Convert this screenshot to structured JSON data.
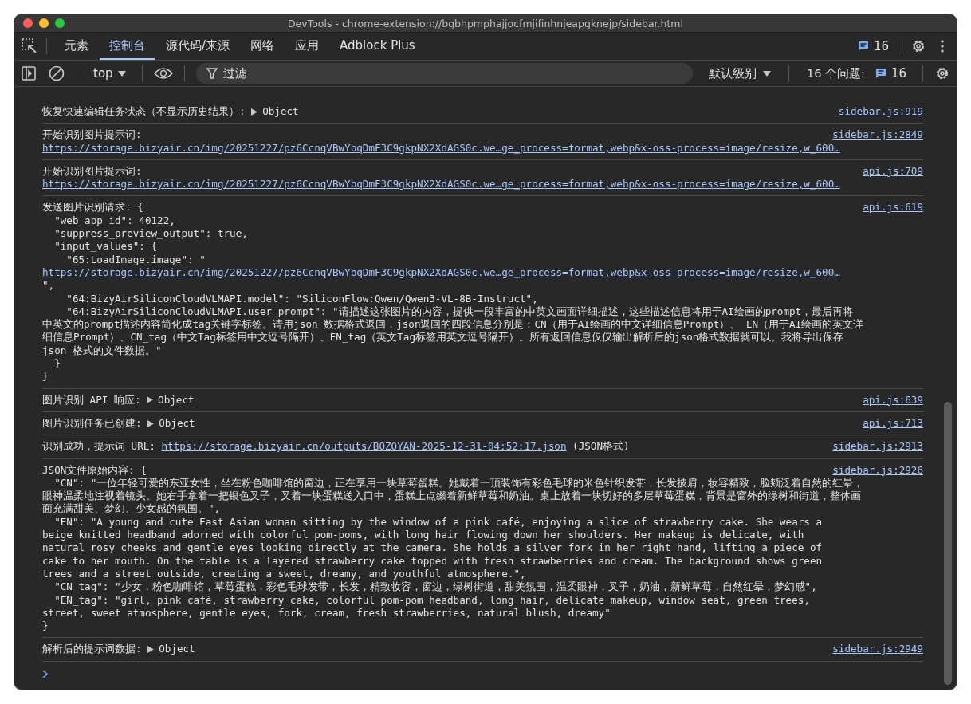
{
  "window": {
    "title": "DevTools - chrome-extension://bgbhpmphajjocfmjifinhnjeapgknejp/sidebar.html"
  },
  "tabs": [
    {
      "label": "元素",
      "selected": false
    },
    {
      "label": "控制台",
      "selected": true
    },
    {
      "label": "源代码/来源",
      "selected": false
    },
    {
      "label": "网络",
      "selected": false
    },
    {
      "label": "应用",
      "selected": false
    },
    {
      "label": "Adblock Plus",
      "selected": false
    }
  ],
  "issues_badge": "16",
  "toolbar": {
    "context": "top",
    "filter": {
      "placeholder": "过滤"
    },
    "level": "默认级别",
    "issues_label": "16 个问题:",
    "issues_count": "16"
  },
  "entries": [
    {
      "source": "sidebar.js:919",
      "lines": [
        [
          {
            "kind": "text",
            "text": "恢复快速编辑任务状态（不显示历史结果）: "
          },
          {
            "kind": "object",
            "text": "Object"
          }
        ]
      ]
    },
    {
      "source": "sidebar.js:2849",
      "lines": [
        [
          {
            "kind": "text",
            "text": "开始识别图片提示词:"
          }
        ],
        [
          {
            "kind": "link",
            "text": "https://storage.bizyair.cn/img/20251227/pz6CcnqVBwYbqDmF3C9gkpNX2XdAGS0c.we…ge_process=format,webp&x-oss-process=image/resize,w_600…"
          }
        ]
      ]
    },
    {
      "source": "api.js:709",
      "lines": [
        [
          {
            "kind": "text",
            "text": "开始识别图片提示词:"
          }
        ],
        [
          {
            "kind": "link",
            "text": "https://storage.bizyair.cn/img/20251227/pz6CcnqVBwYbqDmF3C9gkpNX2XdAGS0c.we…ge_process=format,webp&x-oss-process=image/resize,w_600…"
          }
        ]
      ]
    },
    {
      "source": "api.js:619",
      "lines": [
        [
          {
            "kind": "text",
            "text": "发送图片识别请求: {"
          }
        ],
        [
          {
            "kind": "text",
            "text": "  \"web_app_id\": 40122,"
          }
        ],
        [
          {
            "kind": "text",
            "text": "  \"suppress_preview_output\": true,"
          }
        ],
        [
          {
            "kind": "text",
            "text": "  \"input_values\": {"
          }
        ],
        [
          {
            "kind": "text",
            "text": "    \"65:LoadImage.image\": \""
          }
        ],
        [
          {
            "kind": "link",
            "text": "https://storage.bizyair.cn/img/20251227/pz6CcnqVBwYbqDmF3C9gkpNX2XdAGS0c.we…ge_process=format,webp&x-oss-process=image/resize,w_600…"
          }
        ],
        [
          {
            "kind": "text",
            "text": "\","
          }
        ],
        [
          {
            "kind": "text",
            "text": "    \"64:BizyAirSiliconCloudVLMAPI.model\": \"SiliconFlow:Qwen/Qwen3-VL-8B-Instruct\","
          }
        ],
        [
          {
            "kind": "text",
            "text": "    \"64:BizyAirSiliconCloudVLMAPI.user_prompt\": \"请描述这张图片的内容，提供一段丰富的中英文画面详细描述，这些描述信息将用于AI绘画的prompt，最后再将"
          }
        ],
        [
          {
            "kind": "text",
            "text": "中英文的prompt描述内容简化成tag关键字标签。请用json 数据格式返回，json返回的四段信息分别是：CN（用于AI绘画的中文详细信息Prompt）、 EN（用于AI绘画的英文详"
          }
        ],
        [
          {
            "kind": "text",
            "text": "细信息Prompt）、CN_tag（中文Tag标签用中文逗号隔开）、EN_tag（英文Tag标签用英文逗号隔开）。所有返回信息仅仅输出解析后的json格式数据就可以。我将导出保存"
          }
        ],
        [
          {
            "kind": "text",
            "text": "json 格式的文件数据。\""
          }
        ],
        [
          {
            "kind": "text",
            "text": "  }"
          }
        ],
        [
          {
            "kind": "text",
            "text": "}"
          }
        ]
      ]
    },
    {
      "source": "api.js:639",
      "lines": [
        [
          {
            "kind": "text",
            "text": "图片识别 API 响应: "
          },
          {
            "kind": "object",
            "text": "Object"
          }
        ]
      ]
    },
    {
      "source": "api.js:713",
      "lines": [
        [
          {
            "kind": "text",
            "text": "图片识别任务已创建: "
          },
          {
            "kind": "object",
            "text": "Object"
          }
        ]
      ]
    },
    {
      "source": "sidebar.js:2913",
      "lines": [
        [
          {
            "kind": "text",
            "text": "识别成功，提示词 URL: "
          },
          {
            "kind": "link",
            "text": "https://storage.bizyair.cn/outputs/BOZOYAN-2025-12-31-04:52:17.json"
          },
          {
            "kind": "text",
            "text": " (JSON格式)"
          }
        ]
      ]
    },
    {
      "source": "sidebar.js:2926",
      "lines": [
        [
          {
            "kind": "text",
            "text": "JSON文件原始内容: {"
          }
        ],
        [
          {
            "kind": "text",
            "text": "  \"CN\": \"一位年轻可爱的东亚女性，坐在粉色咖啡馆的窗边，正在享用一块草莓蛋糕。她戴着一顶装饰有彩色毛球的米色针织发带，长发披肩，妆容精致，脸颊泛着自然的红晕，"
          }
        ],
        [
          {
            "kind": "text",
            "text": "眼神温柔地注视着镜头。她右手拿着一把银色叉子，叉着一块蛋糕送入口中，蛋糕上点缀着新鲜草莓和奶油。桌上放着一块切好的多层草莓蛋糕，背景是窗外的绿树和街道，整体画"
          }
        ],
        [
          {
            "kind": "text",
            "text": "面充满甜美、梦幻、少女感的氛围。\","
          }
        ],
        [
          {
            "kind": "text",
            "text": "  \"EN\": \"A young and cute East Asian woman sitting by the window of a pink café, enjoying a slice of strawberry cake. She wears a"
          }
        ],
        [
          {
            "kind": "text",
            "text": "beige knitted headband adorned with colorful pom-poms, with long hair flowing down her shoulders. Her makeup is delicate, with"
          }
        ],
        [
          {
            "kind": "text",
            "text": "natural rosy cheeks and gentle eyes looking directly at the camera. She holds a silver fork in her right hand, lifting a piece of"
          }
        ],
        [
          {
            "kind": "text",
            "text": "cake to her mouth. On the table is a layered strawberry cake topped with fresh strawberries and cream. The background shows green"
          }
        ],
        [
          {
            "kind": "text",
            "text": "trees and a street outside, creating a sweet, dreamy, and youthful atmosphere.\","
          }
        ],
        [
          {
            "kind": "text",
            "text": "  \"CN_tag\": \"少女，粉色咖啡馆，草莓蛋糕，彩色毛球发带，长发，精致妆容，窗边，绿树街道，甜美氛围，温柔眼神，叉子，奶油，新鲜草莓，自然红晕，梦幻感\","
          }
        ],
        [
          {
            "kind": "text",
            "text": "  \"EN_tag\": \"girl, pink café, strawberry cake, colorful pom-pom headband, long hair, delicate makeup, window seat, green trees,"
          }
        ],
        [
          {
            "kind": "text",
            "text": "street, sweet atmosphere, gentle eyes, fork, cream, fresh strawberries, natural blush, dreamy\""
          }
        ],
        [
          {
            "kind": "text",
            "text": "}"
          }
        ]
      ]
    },
    {
      "source": "sidebar.js:2949",
      "lines": [
        [
          {
            "kind": "text",
            "text": "解析后的提示词数据: "
          },
          {
            "kind": "object",
            "text": "Object"
          }
        ]
      ]
    }
  ]
}
